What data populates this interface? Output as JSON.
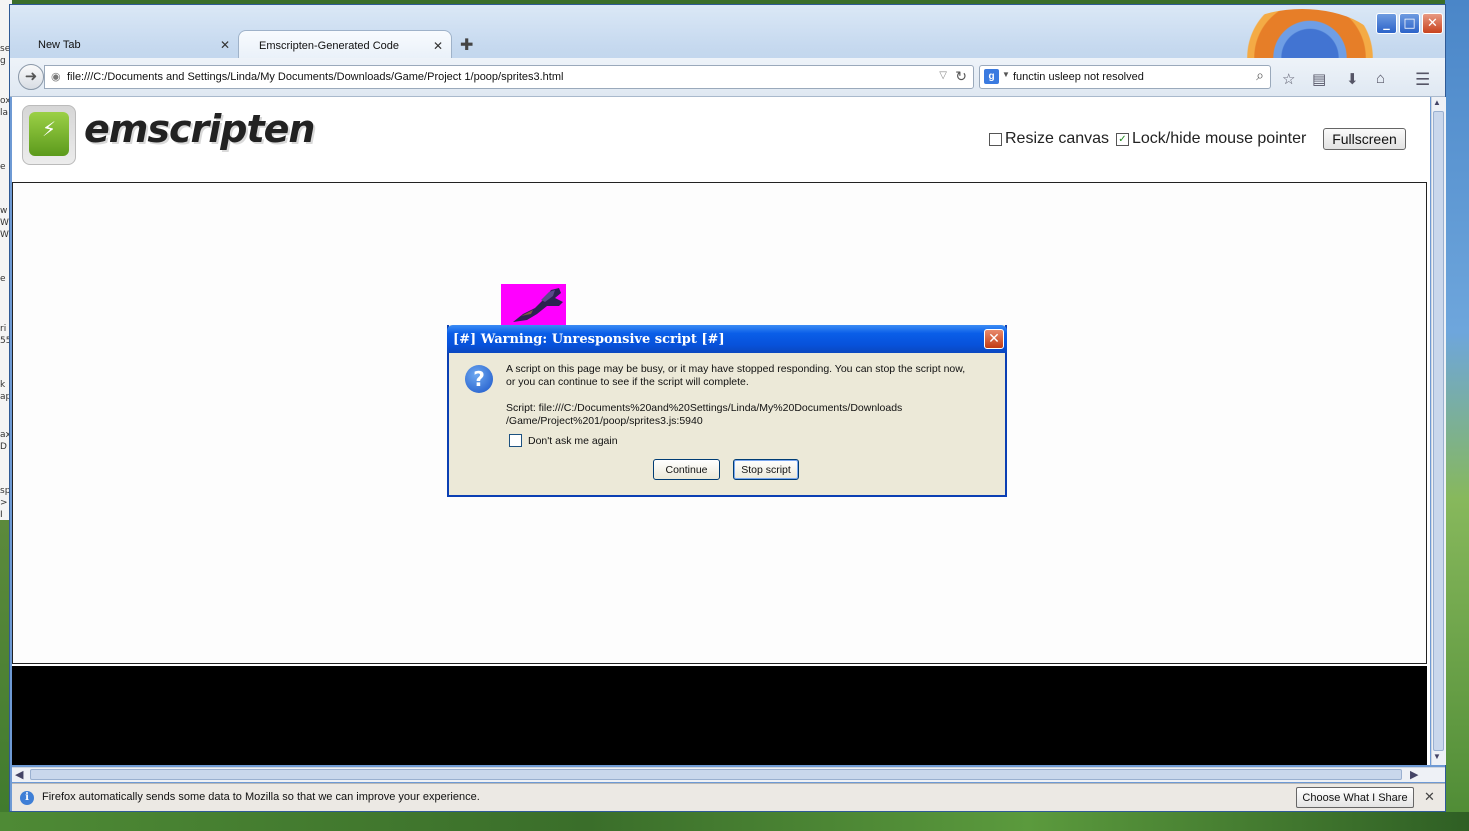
{
  "browser": {
    "tabs": [
      {
        "label": "New Tab"
      },
      {
        "label": "Emscripten-Generated Code"
      }
    ],
    "url": "file:///C:/Documents and Settings/Linda/My Documents/Downloads/Game/Project 1/poop/sprites3.html",
    "search_value": "functin usleep not resolved",
    "search_engine_icon": "google-icon"
  },
  "page": {
    "logo_text": "emscripten",
    "options": {
      "resize_canvas_label": "Resize canvas",
      "resize_canvas_checked": false,
      "lock_pointer_label": "Lock/hide mouse pointer",
      "lock_pointer_checked": true
    },
    "fullscreen_label": "Fullscreen"
  },
  "dialog": {
    "title": "[#] Warning: Unresponsive script [#]",
    "message_line1": "A script on this page may be busy, or it may have stopped responding. You can stop the script now,",
    "message_line2": "or you can continue to see if the script will complete.",
    "script_line1": "Script: file:///C:/Documents%20and%20Settings/Linda/My%20Documents/Downloads",
    "script_line2": "/Game/Project%201/poop/sprites3.js:5940",
    "dont_ask_label": "Don't ask me again",
    "continue_label": "Continue",
    "stop_label": "Stop script"
  },
  "notification": {
    "message": "Firefox automatically sends some data to Mozilla so that we can improve your experience.",
    "button_label": "Choose What I Share"
  },
  "colors": {
    "sprite_background": "#ff00ff",
    "dialog_titlebar": "#0a5ee8",
    "console_background": "#000000"
  }
}
